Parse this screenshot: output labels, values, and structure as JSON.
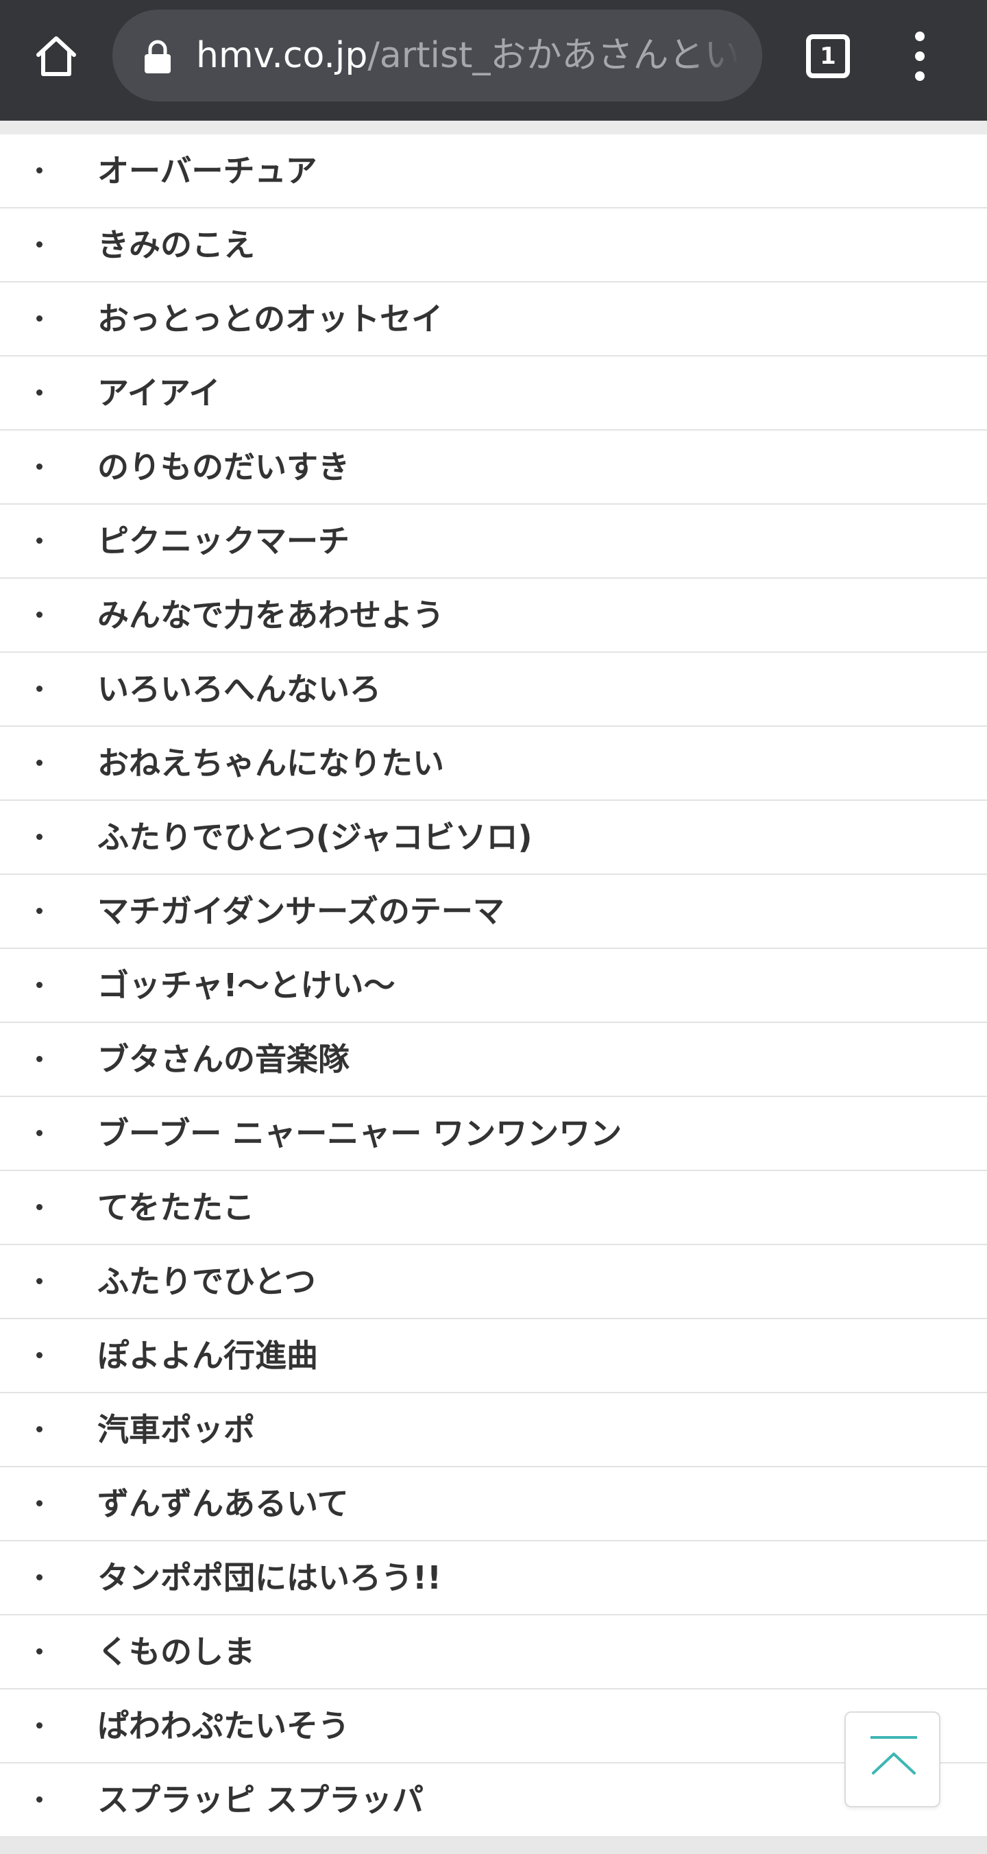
{
  "browser": {
    "url_host": "hmv.co.jp",
    "url_path": "/artist_おかあさんとい",
    "tab_count": "1"
  },
  "song_list": [
    "オーバーチュア",
    "きみのこえ",
    "おっとっとのオットセイ",
    "アイアイ",
    "のりものだいすき",
    "ピクニックマーチ",
    "みんなで力をあわせよう",
    "いろいろへんないろ",
    "おねえちゃんになりたい",
    "ふたりでひとつ(ジャコビソロ)",
    "マチガイダンサーズのテーマ",
    "ゴッチャ!〜とけい〜",
    "ブタさんの音楽隊",
    "ブーブー ニャーニャー ワンワンワン",
    "てをたたこ",
    "ふたりでひとつ",
    "ぽよよん行進曲",
    "汽車ポッポ",
    "ずんずんあるいて",
    "タンポポ団にはいろう!!",
    "くものしま",
    "ぱわわぷたいそう",
    "スプラッピ スプラッパ"
  ],
  "icons": {
    "home": "home-icon",
    "lock": "lock-icon",
    "menu": "more-vert-icon",
    "back_to_top": "chevron-up-icon"
  },
  "colors": {
    "toolbar": "#35363a",
    "omnibox": "#4a4b50",
    "text": "#333333",
    "accent": "#3fb6b4"
  }
}
